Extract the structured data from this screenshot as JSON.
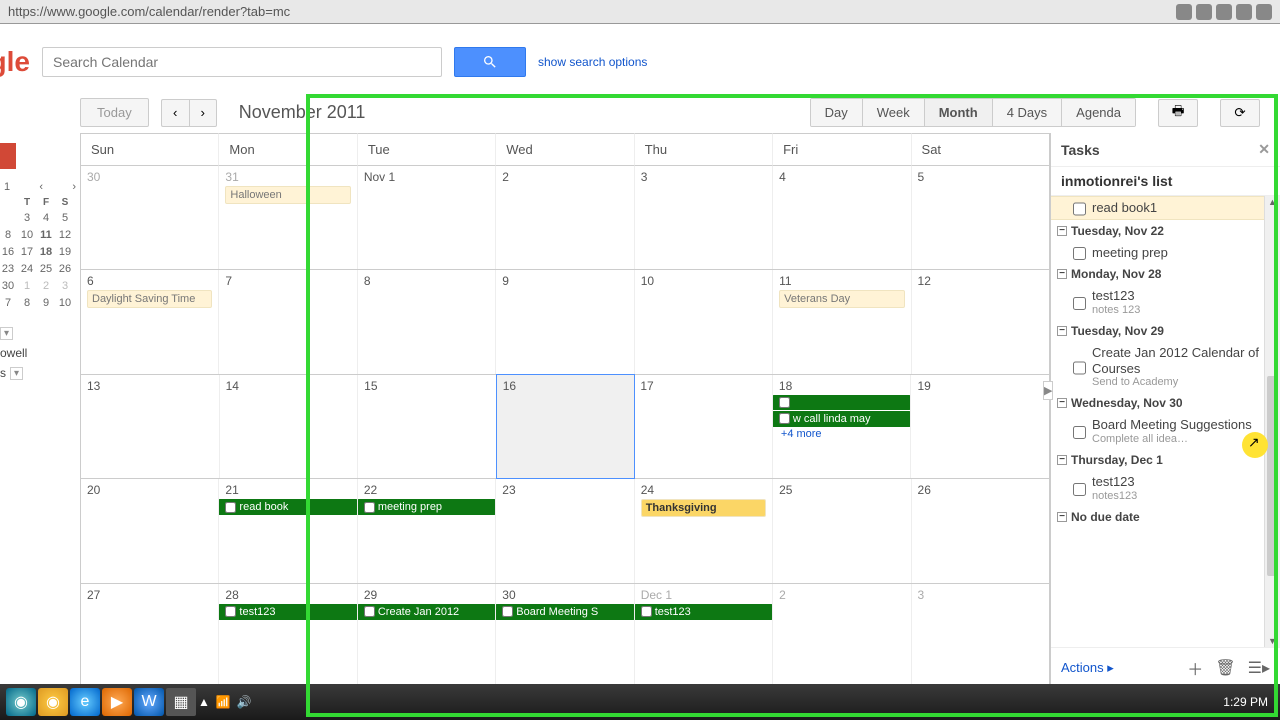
{
  "url": "https://www.google.com/calendar/render?tab=mc",
  "logo": "gle",
  "search": {
    "placeholder": "Search Calendar",
    "show_options": "show search options"
  },
  "toolbar": {
    "today": "Today",
    "month_label": "November 2011",
    "views": [
      "Day",
      "Week",
      "Month",
      "4 Days",
      "Agenda"
    ],
    "active_view": 2
  },
  "mini_cal": {
    "heads": [
      "T",
      "F",
      "S"
    ],
    "rows": [
      [
        {
          "n": "3"
        },
        {
          "n": "4"
        },
        {
          "n": "5"
        }
      ],
      [
        {
          "n": "10"
        },
        {
          "n": "11",
          "b": true
        },
        {
          "n": "12"
        }
      ],
      [
        {
          "n": "17"
        },
        {
          "n": "18",
          "b": true
        },
        {
          "n": "19"
        }
      ],
      [
        {
          "n": "24"
        },
        {
          "n": "25"
        },
        {
          "n": "26"
        }
      ],
      [
        {
          "n": "1",
          "g": true
        },
        {
          "n": "2",
          "g": true
        },
        {
          "n": "3",
          "g": true
        }
      ],
      [
        {
          "n": "8"
        },
        {
          "n": "9"
        },
        {
          "n": "10"
        }
      ]
    ],
    "nav_left": "‹",
    "nav_right": "›",
    "prev_col": [
      "",
      "8",
      "16",
      "23",
      "30",
      "7"
    ],
    "owell": "owell",
    "s_label": "s"
  },
  "day_headers": [
    "Sun",
    "Mon",
    "Tue",
    "Wed",
    "Thu",
    "Fri",
    "Sat"
  ],
  "weeks": [
    [
      {
        "n": "30",
        "gray": true
      },
      {
        "n": "31",
        "gray": true,
        "events": [
          {
            "type": "holiday",
            "label": "Halloween"
          }
        ]
      },
      {
        "n": "Nov 1"
      },
      {
        "n": "2"
      },
      {
        "n": "3"
      },
      {
        "n": "4"
      },
      {
        "n": "5"
      }
    ],
    [
      {
        "n": "6",
        "events": [
          {
            "type": "holiday",
            "label": "Daylight Saving Time"
          }
        ]
      },
      {
        "n": "7"
      },
      {
        "n": "8"
      },
      {
        "n": "9"
      },
      {
        "n": "10"
      },
      {
        "n": "11",
        "events": [
          {
            "type": "holiday",
            "label": "Veterans Day"
          }
        ]
      },
      {
        "n": "12"
      }
    ],
    [
      {
        "n": "13"
      },
      {
        "n": "14"
      },
      {
        "n": "15"
      },
      {
        "n": "16",
        "today": true
      },
      {
        "n": "17"
      },
      {
        "n": "18",
        "events": [
          {
            "type": "task",
            "label": ""
          },
          {
            "type": "task",
            "label": "w call linda may"
          }
        ],
        "more": "+4 more"
      },
      {
        "n": "19"
      }
    ],
    [
      {
        "n": "20"
      },
      {
        "n": "21",
        "events": [
          {
            "type": "task",
            "label": "read book"
          }
        ]
      },
      {
        "n": "22",
        "events": [
          {
            "type": "task",
            "label": "meeting prep"
          }
        ]
      },
      {
        "n": "23"
      },
      {
        "n": "24",
        "events": [
          {
            "type": "holiday",
            "label": "Thanksgiving",
            "strong": true
          }
        ]
      },
      {
        "n": "25"
      },
      {
        "n": "26"
      }
    ],
    [
      {
        "n": "27"
      },
      {
        "n": "28",
        "events": [
          {
            "type": "task",
            "label": "test123"
          }
        ]
      },
      {
        "n": "29",
        "events": [
          {
            "type": "task",
            "label": "Create Jan 2012"
          }
        ]
      },
      {
        "n": "30",
        "events": [
          {
            "type": "task",
            "label": "Board Meeting S"
          }
        ]
      },
      {
        "n": "Dec 1",
        "gray": true,
        "events": [
          {
            "type": "task",
            "label": "test123"
          }
        ]
      },
      {
        "n": "2",
        "gray": true
      },
      {
        "n": "3",
        "gray": true
      }
    ]
  ],
  "tasks": {
    "title": "Tasks",
    "list_name": "inmotionrei's list",
    "groups": [
      {
        "selected_item": {
          "label": "read book1"
        }
      },
      {
        "head": "Tuesday, Nov 22",
        "items": [
          {
            "label": "meeting prep"
          }
        ]
      },
      {
        "head": "Monday, Nov 28",
        "items": [
          {
            "label": "test123",
            "sub": "notes 123"
          }
        ]
      },
      {
        "head": "Tuesday, Nov 29",
        "items": [
          {
            "label": "Create Jan 2012 Calendar of Courses",
            "sub": "Send to Academy"
          }
        ]
      },
      {
        "head": "Wednesday, Nov 30",
        "items": [
          {
            "label": "Board Meeting Suggestions",
            "sub": "Complete all idea…"
          }
        ]
      },
      {
        "head": "Thursday, Dec 1",
        "items": [
          {
            "label": "test123",
            "sub": "notes123"
          }
        ]
      },
      {
        "head": "No due date"
      }
    ],
    "actions": "Actions ▸"
  },
  "taskbar": {
    "clock": "1:29 PM"
  }
}
